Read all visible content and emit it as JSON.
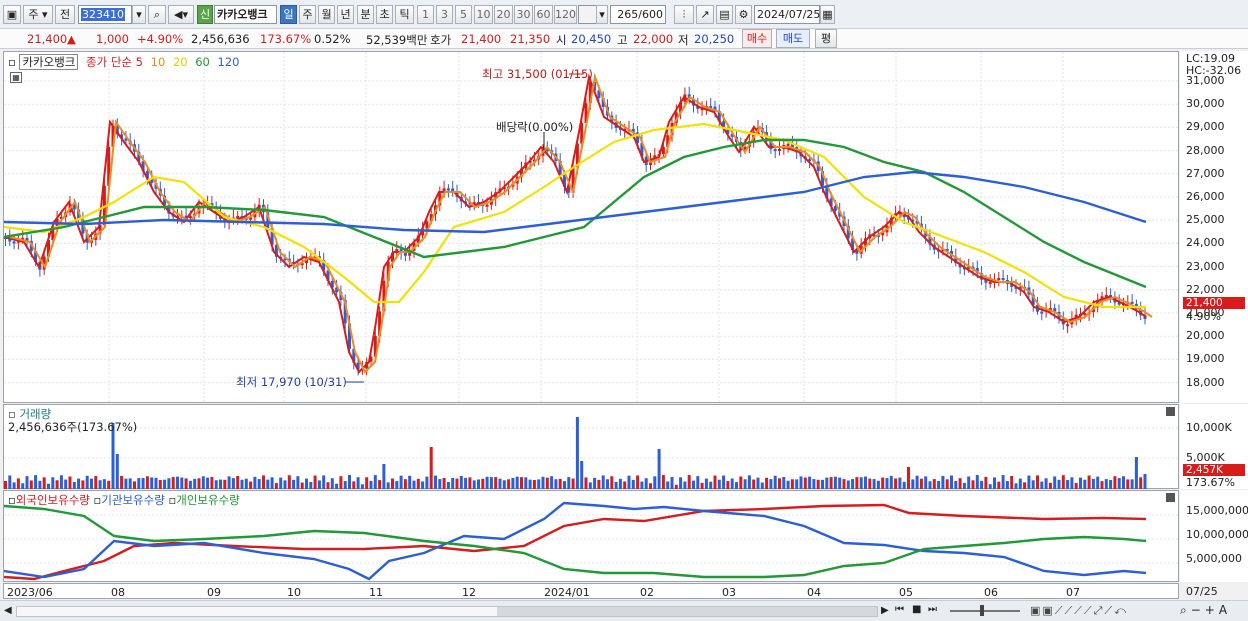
{
  "toolbar": {
    "period_type": "주",
    "prev": "전",
    "code": "323410",
    "credit_badge": "신",
    "stock_name": "카카오뱅크",
    "period_tabs": [
      "일",
      "주",
      "월",
      "년",
      "분",
      "초",
      "틱"
    ],
    "interval_tabs": [
      "1",
      "3",
      "5",
      "10",
      "20",
      "30",
      "60",
      "120"
    ],
    "count": "265",
    "count_total": "/600",
    "date": "2024/07/25"
  },
  "quote": {
    "price": "21,400",
    "change": "1,000",
    "change_pct": "+4.90%",
    "volume": "2,456,636",
    "volume_ratio": "173.67%",
    "turnover": "0.52%",
    "amount": "52,539백만",
    "label_bid": "호가",
    "ask": "21,400",
    "bid": "21,350",
    "label_open": "시",
    "open": "20,450",
    "label_high": "고",
    "high": "22,000",
    "label_low": "저",
    "low": "20,250",
    "buy": "매수",
    "sell": "매도",
    "eval": "평"
  },
  "price_chart": {
    "legend_name": "카카오뱅크",
    "legend_ma_prefix": "종가 단순",
    "ma_periods": [
      "5",
      "10",
      "20",
      "60",
      "120"
    ],
    "ma_colors": [
      "#d81c1c",
      "#f08a1c",
      "#f5e000",
      "#1f9a36",
      "#2b5fd9"
    ],
    "high_annotation": "최고 31,500 (01/15)",
    "low_annotation": "최저 17,970 (10/31)",
    "div_annotation": "배당락(0.00%)",
    "lc": "LC:19.09",
    "hc": "HC:-32.06",
    "y_ticks": [
      "31,000",
      "30,000",
      "29,000",
      "28,000",
      "27,000",
      "26,000",
      "25,000",
      "24,000",
      "23,000",
      "22,000",
      "21,000",
      "20,000",
      "19,000",
      "18,000"
    ],
    "last_price": "21,400",
    "last_pct": "4.90%"
  },
  "volume_chart": {
    "title": "거래량",
    "value": "2,456,636주(173.67%)",
    "y_ticks": [
      "10,000K",
      "5,000K"
    ],
    "last": "2,457K",
    "last_pct": "173.67%"
  },
  "holding_chart": {
    "series": [
      "외국인보유수량",
      "기관보유수량",
      "개인보유수량"
    ],
    "colors": [
      "#d81c1c",
      "#2b5fd9",
      "#1f9a36"
    ],
    "y_ticks": [
      "15,000,000",
      "10,000,000",
      "5,000,000"
    ]
  },
  "x_axis": {
    "labels": [
      "2023/06",
      "08",
      "09",
      "10",
      "11",
      "12",
      "2024/01",
      "02",
      "03",
      "04",
      "05",
      "06",
      "07"
    ],
    "end_date": "07/25"
  }
}
